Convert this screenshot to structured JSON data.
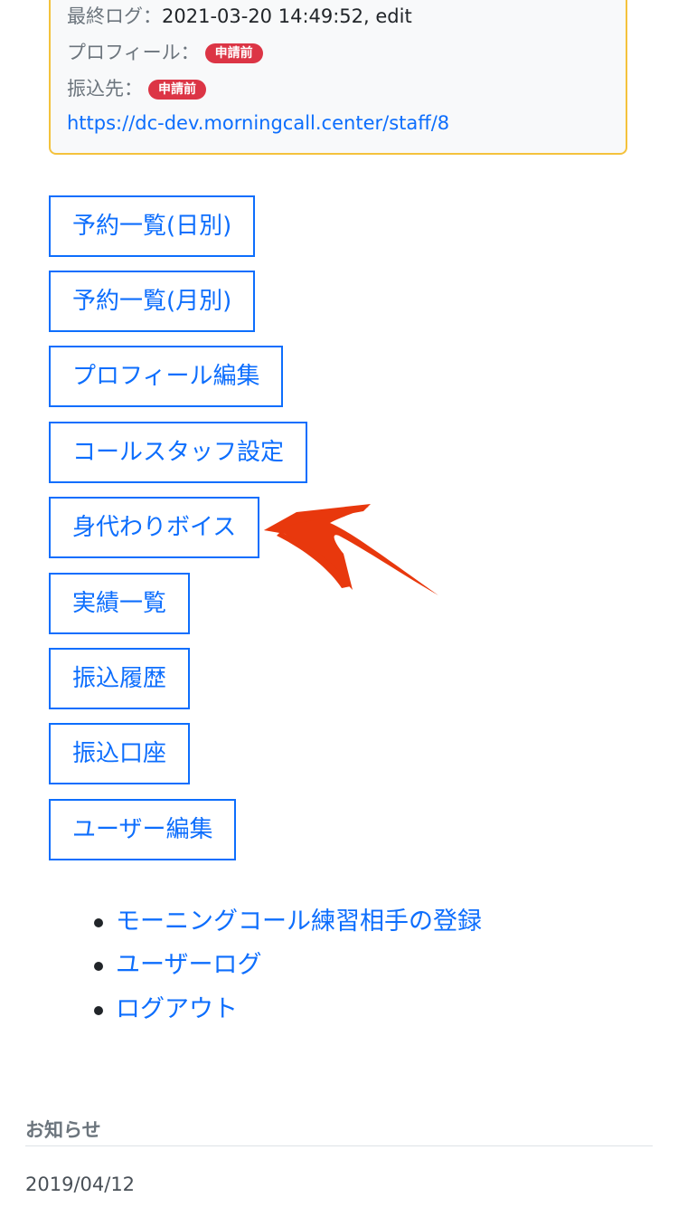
{
  "info": {
    "last_log_label": "最終ログ：",
    "last_log_value": "2021-03-20 14:49:52, edit",
    "profile_label": "プロフィール：",
    "profile_status": "申請前",
    "transfer_label": "振込先：",
    "transfer_status": "申請前",
    "staff_url": "https://dc-dev.morningcall.center/staff/8",
    "status_color": "#dc3545"
  },
  "menu": [
    {
      "label": "予約一覧(日別)"
    },
    {
      "label": "予約一覧(月別)"
    },
    {
      "label": "プロフィール編集"
    },
    {
      "label": "コールスタッフ設定"
    },
    {
      "label": "身代わりボイス"
    },
    {
      "label": "実績一覧"
    },
    {
      "label": "振込履歴"
    },
    {
      "label": "振込口座"
    },
    {
      "label": "ユーザー編集"
    }
  ],
  "links": [
    {
      "label": "モーニングコール練習相手の登録"
    },
    {
      "label": "ユーザーログ"
    },
    {
      "label": "ログアウト"
    }
  ],
  "news": {
    "heading": "お知らせ",
    "date": "2019/04/12"
  },
  "annotation": {
    "arrow_color": "#e8380d",
    "points_to": "身代わりボイス"
  },
  "colors": {
    "accent": "#0d6efd",
    "card_border": "#f4c23c"
  }
}
